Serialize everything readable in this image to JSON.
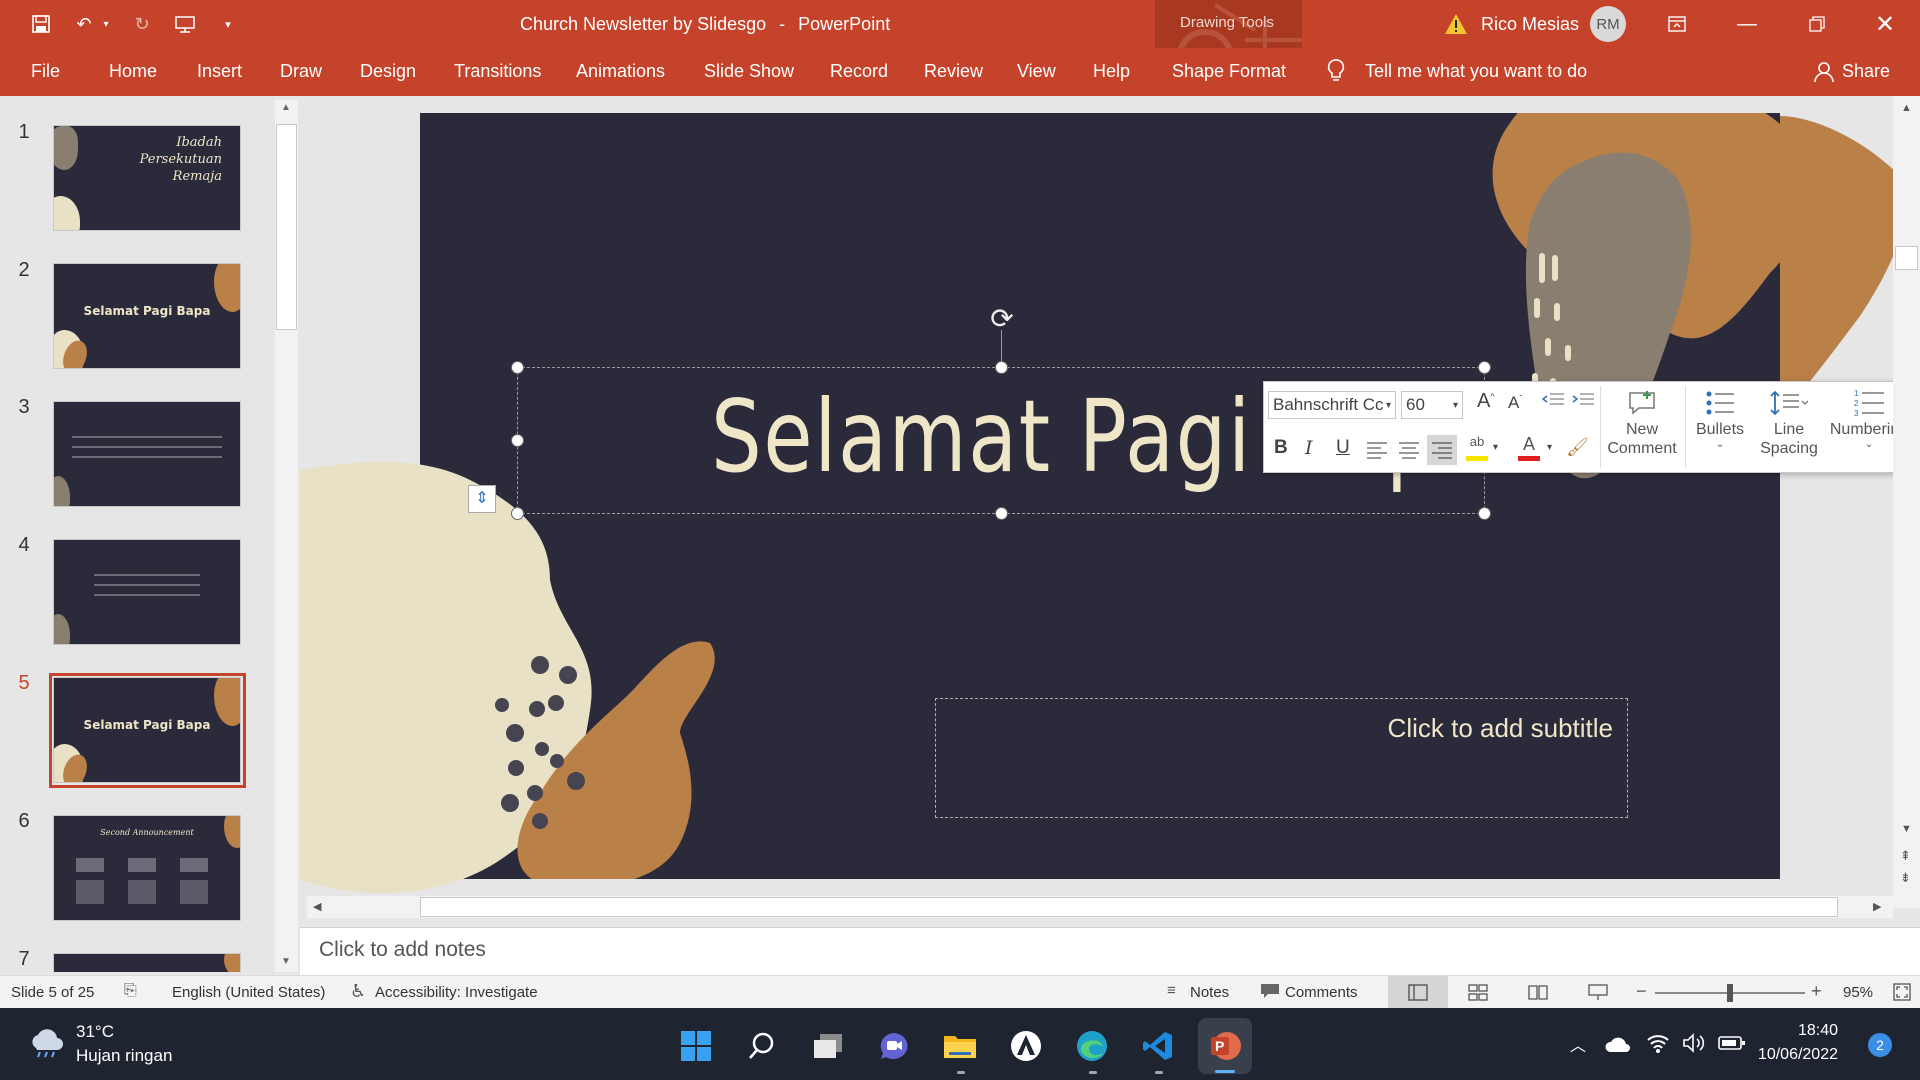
{
  "titlebar": {
    "doc_title": "Church Newsletter by Slidesgo",
    "separator": "-",
    "app_name": "PowerPoint",
    "context_group": "Drawing Tools",
    "user_name": "Rico Mesias",
    "user_initials": "RM"
  },
  "ribbon": {
    "tabs": [
      "File",
      "Home",
      "Insert",
      "Draw",
      "Design",
      "Transitions",
      "Animations",
      "Slide Show",
      "Record",
      "Review",
      "View",
      "Help",
      "Shape Format"
    ],
    "tell_me": "Tell me what you want to do",
    "share": "Share"
  },
  "thumbnails": {
    "numbers": [
      "1",
      "2",
      "3",
      "4",
      "5",
      "6",
      "7"
    ],
    "slide1_lines": [
      "Ibadah",
      "Persekutuan",
      "Remaja"
    ],
    "slide2_title": "Selamat Pagi Bapa",
    "slide5_title": "Selamat Pagi Bapa",
    "slide6_title": "Second Announcement"
  },
  "slide": {
    "title": "Selamat Pagi Bapa",
    "subtitle_placeholder": "Click to add subtitle"
  },
  "mini_toolbar": {
    "font_name": "Bahnschrift Cc",
    "font_size": "60",
    "bold": "B",
    "italic": "I",
    "underline": "U",
    "new_comment_1": "New",
    "new_comment_2": "Comment",
    "bullets": "Bullets",
    "line_spacing_1": "Line",
    "line_spacing_2": "Spacing",
    "numbering": "Numbering"
  },
  "notes": {
    "placeholder": "Click to add notes"
  },
  "statusbar": {
    "slide_info": "Slide 5 of 25",
    "language": "English (United States)",
    "accessibility": "Accessibility: Investigate",
    "notes": "Notes",
    "comments": "Comments",
    "zoom": "95%",
    "zoom_fraction": 0.5
  },
  "taskbar": {
    "temperature": "31°C",
    "weather": "Hujan ringan",
    "time": "18:40",
    "date": "10/06/2022",
    "notification_count": "2"
  },
  "colors": {
    "accent": "#c5432a",
    "slide_bg": "#2a2a3a",
    "cream": "#e9e1c5",
    "tan": "#b98048",
    "taupe": "#8a7e70"
  }
}
